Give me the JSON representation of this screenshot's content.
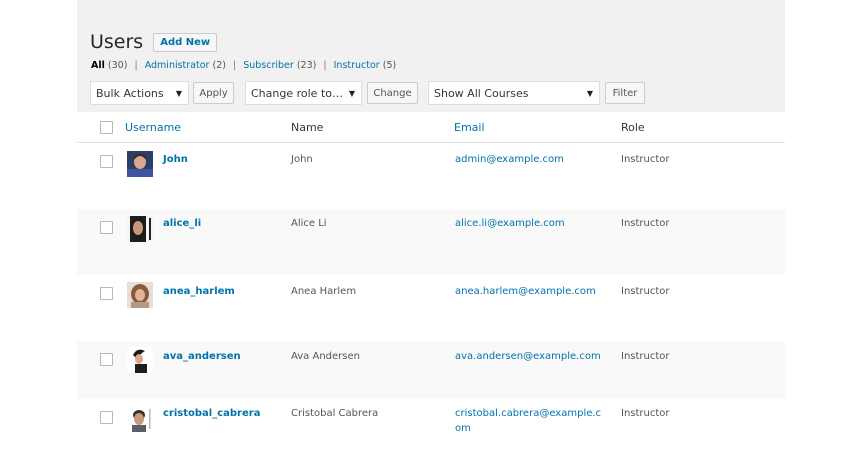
{
  "header": {
    "title": "Users",
    "add_new": "Add New"
  },
  "filters": {
    "all": "All",
    "all_count": "(30)",
    "administrator": "Administrator",
    "administrator_count": "(2)",
    "subscriber": "Subscriber",
    "subscriber_count": "(23)",
    "instructor": "Instructor",
    "instructor_count": "(5)",
    "sep": "|"
  },
  "toolbar": {
    "bulk_actions": "Bulk Actions",
    "apply": "Apply",
    "change_role": "Change role to…",
    "change": "Change",
    "courses": "Show All Courses",
    "filter": "Filter"
  },
  "table": {
    "columns": {
      "username": "Username",
      "name": "Name",
      "email": "Email",
      "role": "Role"
    },
    "rows": [
      {
        "username": "John",
        "name": "John",
        "email": "admin@example.com",
        "role": "Instructor"
      },
      {
        "username": "alice_li",
        "name": "Alice Li",
        "email": "alice.li@example.com",
        "role": "Instructor"
      },
      {
        "username": "anea_harlem",
        "name": "Anea Harlem",
        "email": "anea.harlem@example.com",
        "role": "Instructor"
      },
      {
        "username": "ava_andersen",
        "name": "Ava Andersen",
        "email": "ava.andersen@example.com",
        "role": "Instructor"
      },
      {
        "username": "cristobal_cabrera",
        "name": "Cristobal Cabrera",
        "email_line1": "cristobal.cabrera@example.c",
        "email_line2": "om",
        "role": "Instructor"
      }
    ]
  },
  "colors": {
    "link": "#0073aa",
    "panel": "#f1f1f1",
    "alt_row": "#f9f9f9"
  }
}
